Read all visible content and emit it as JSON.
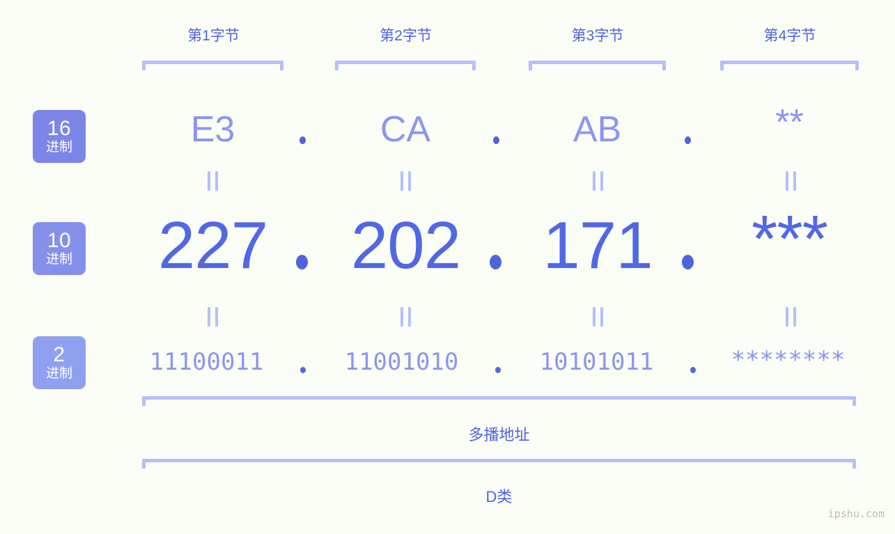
{
  "background_color": "#fbfdf7",
  "accent_strong": "#4e63dd",
  "accent_light": "#8a96ee",
  "accent_pale": "#b4c0fb",
  "byte_headers": [
    {
      "label": "第1字节"
    },
    {
      "label": "第2字节"
    },
    {
      "label": "第3字节"
    },
    {
      "label": "第4字节"
    }
  ],
  "base_badges": [
    {
      "number": "16",
      "system": "进制",
      "color": "#7b86e8"
    },
    {
      "number": "10",
      "system": "进制",
      "color": "#8490ec"
    },
    {
      "number": "2",
      "system": "进制",
      "color": "#8fa0f0"
    }
  ],
  "rows": {
    "hex": {
      "base_label": "16",
      "values": [
        "E3",
        "CA",
        "AB",
        "**"
      ],
      "separators": [
        ".",
        ".",
        "."
      ]
    },
    "decimal": {
      "base_label": "10",
      "values": [
        "227",
        "202",
        "171",
        "***"
      ],
      "separators": [
        ".",
        ".",
        "."
      ]
    },
    "binary": {
      "base_label": "2",
      "values": [
        "11100011",
        "11001010",
        "10101011",
        "********"
      ],
      "separators": [
        ".",
        ".",
        "."
      ]
    }
  },
  "equals_marker": "=",
  "summary": [
    {
      "label": "多播地址"
    },
    {
      "label": "D类"
    }
  ],
  "watermark": "ipshu.com"
}
